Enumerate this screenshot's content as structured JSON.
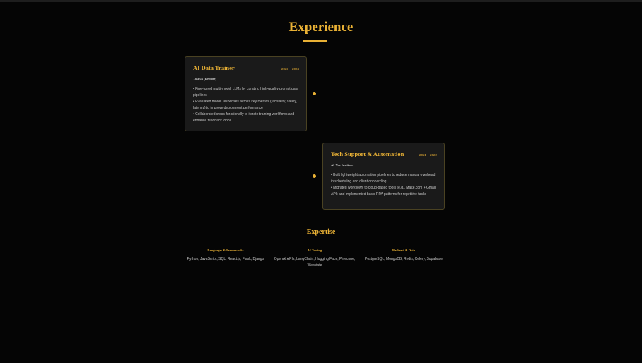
{
  "section_title": "Experience",
  "experience": [
    {
      "title": "AI Data Trainer",
      "dates": "2023 – 2024",
      "company": "TaskUs (Remote)",
      "bullets": [
        "• Fine-tuned multi-model LLMs by curating high-quality prompt data pipelines",
        "• Evaluated model responses across key metrics (factuality, safety, latency) to improve deployment performance",
        "• Collaborated cross-functionally to iterate training workflows and enhance feedback loops"
      ]
    },
    {
      "title": "Tech Support & Automation",
      "dates": "2021 – 2022",
      "company": "AI-Vue Institute",
      "bullets": [
        "• Built lightweight automation pipelines to reduce manual overhead in scheduling and client onboarding",
        "• Migrated workflows to cloud-based tools (e.g., Make.com + Gmail API) and implemented basic RPA patterns for repetitive tasks"
      ]
    }
  ],
  "expertise": {
    "title": "Expertise",
    "columns": [
      {
        "heading": "Languages & Frameworks",
        "items": "Python, JavaScript, SQL, React.js, Flask, Django"
      },
      {
        "heading": "AI Tooling",
        "items": "OpenAI APIs, LangChain, Hugging Face, Pinecone, Weaviate"
      },
      {
        "heading": "Backend & Data",
        "items": "PostgreSQL, MongoDB, Redis, Celery, Supabase"
      }
    ]
  },
  "colors": {
    "accent": "#e9b135",
    "background": "#050505",
    "card": "#1a1a1a"
  }
}
